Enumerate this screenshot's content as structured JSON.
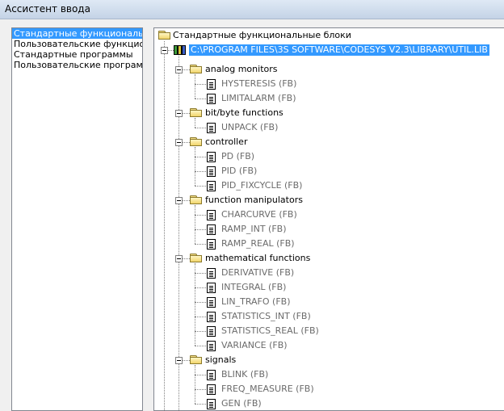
{
  "window": {
    "title": "Ассистент ввода"
  },
  "categories": {
    "items": [
      {
        "label": "Стандартные функциональные блоки",
        "selected": true
      },
      {
        "label": "Пользовательские функциональные блоки",
        "selected": false
      },
      {
        "label": "Стандартные программы",
        "selected": false
      },
      {
        "label": "Пользовательские программы",
        "selected": false
      }
    ]
  },
  "tree": {
    "root_label": "Стандартные функциональные блоки",
    "library_path": "C:\\PROGRAM FILES\\3S SOFTWARE\\CODESYS V2.3\\LIBRARY\\UTIL.LIB",
    "groups": [
      {
        "label": "analog monitors",
        "items": [
          "HYSTERESIS (FB)",
          "LIMITALARM (FB)"
        ]
      },
      {
        "label": "bit/byte functions",
        "items": [
          "UNPACK (FB)"
        ]
      },
      {
        "label": "controller",
        "items": [
          "PD (FB)",
          "PID (FB)",
          "PID_FIXCYCLE (FB)"
        ]
      },
      {
        "label": "function manipulators",
        "items": [
          "CHARCURVE (FB)",
          "RAMP_INT (FB)",
          "RAMP_REAL (FB)"
        ]
      },
      {
        "label": "mathematical functions",
        "items": [
          "DERIVATIVE (FB)",
          "INTEGRAL (FB)",
          "LIN_TRAFO (FB)",
          "STATISTICS_INT (FB)",
          "STATISTICS_REAL (FB)",
          "VARIANCE (FB)"
        ]
      },
      {
        "label": "signals",
        "items": [
          "BLINK (FB)",
          "FREQ_MEASURE (FB)",
          "GEN (FB)"
        ]
      }
    ]
  },
  "colors": {
    "selection": "#3399ff",
    "fb_text": "#6b6b6b",
    "folder": "#f1d56b"
  },
  "icons": {
    "root": "open-folder-icon",
    "library": "library-books-icon",
    "group": "folder-icon",
    "item": "document-icon",
    "expander": "minus-expander-icon"
  }
}
